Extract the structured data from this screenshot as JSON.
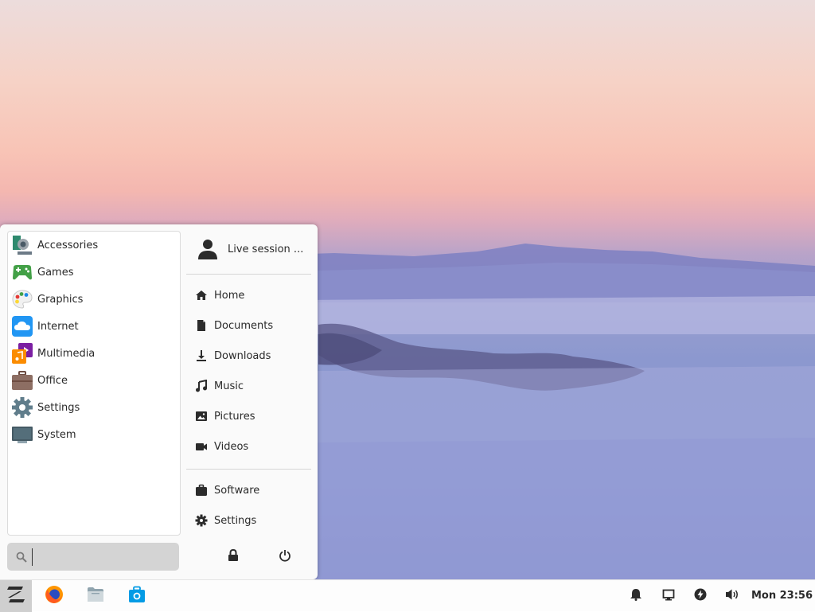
{
  "menu": {
    "categories": [
      {
        "label": "Accessories",
        "icon": "accessories-icon"
      },
      {
        "label": "Games",
        "icon": "games-icon"
      },
      {
        "label": "Graphics",
        "icon": "graphics-icon"
      },
      {
        "label": "Internet",
        "icon": "internet-icon"
      },
      {
        "label": "Multimedia",
        "icon": "multimedia-icon"
      },
      {
        "label": "Office",
        "icon": "office-icon"
      },
      {
        "label": "Settings",
        "icon": "settings-icon"
      },
      {
        "label": "System",
        "icon": "system-icon"
      }
    ],
    "search": {
      "value": "",
      "placeholder": ""
    },
    "user": {
      "label": "Live session ..."
    },
    "places": [
      {
        "label": "Home",
        "icon": "home-icon"
      },
      {
        "label": "Documents",
        "icon": "document-icon"
      },
      {
        "label": "Downloads",
        "icon": "download-icon"
      },
      {
        "label": "Music",
        "icon": "music-icon"
      },
      {
        "label": "Pictures",
        "icon": "picture-icon"
      },
      {
        "label": "Videos",
        "icon": "video-icon"
      }
    ],
    "system_links": [
      {
        "label": "Software",
        "icon": "software-bag-icon"
      },
      {
        "label": "Settings",
        "icon": "gear-icon"
      }
    ],
    "actions": [
      "lock-icon",
      "power-icon"
    ]
  },
  "taskbar": {
    "launchers": [
      "zorin-menu-icon",
      "firefox-icon",
      "files-icon",
      "software-store-icon"
    ],
    "tray": [
      "bell-icon",
      "display-icon",
      "power-status-icon",
      "volume-icon"
    ],
    "clock": "Mon 23:56"
  }
}
